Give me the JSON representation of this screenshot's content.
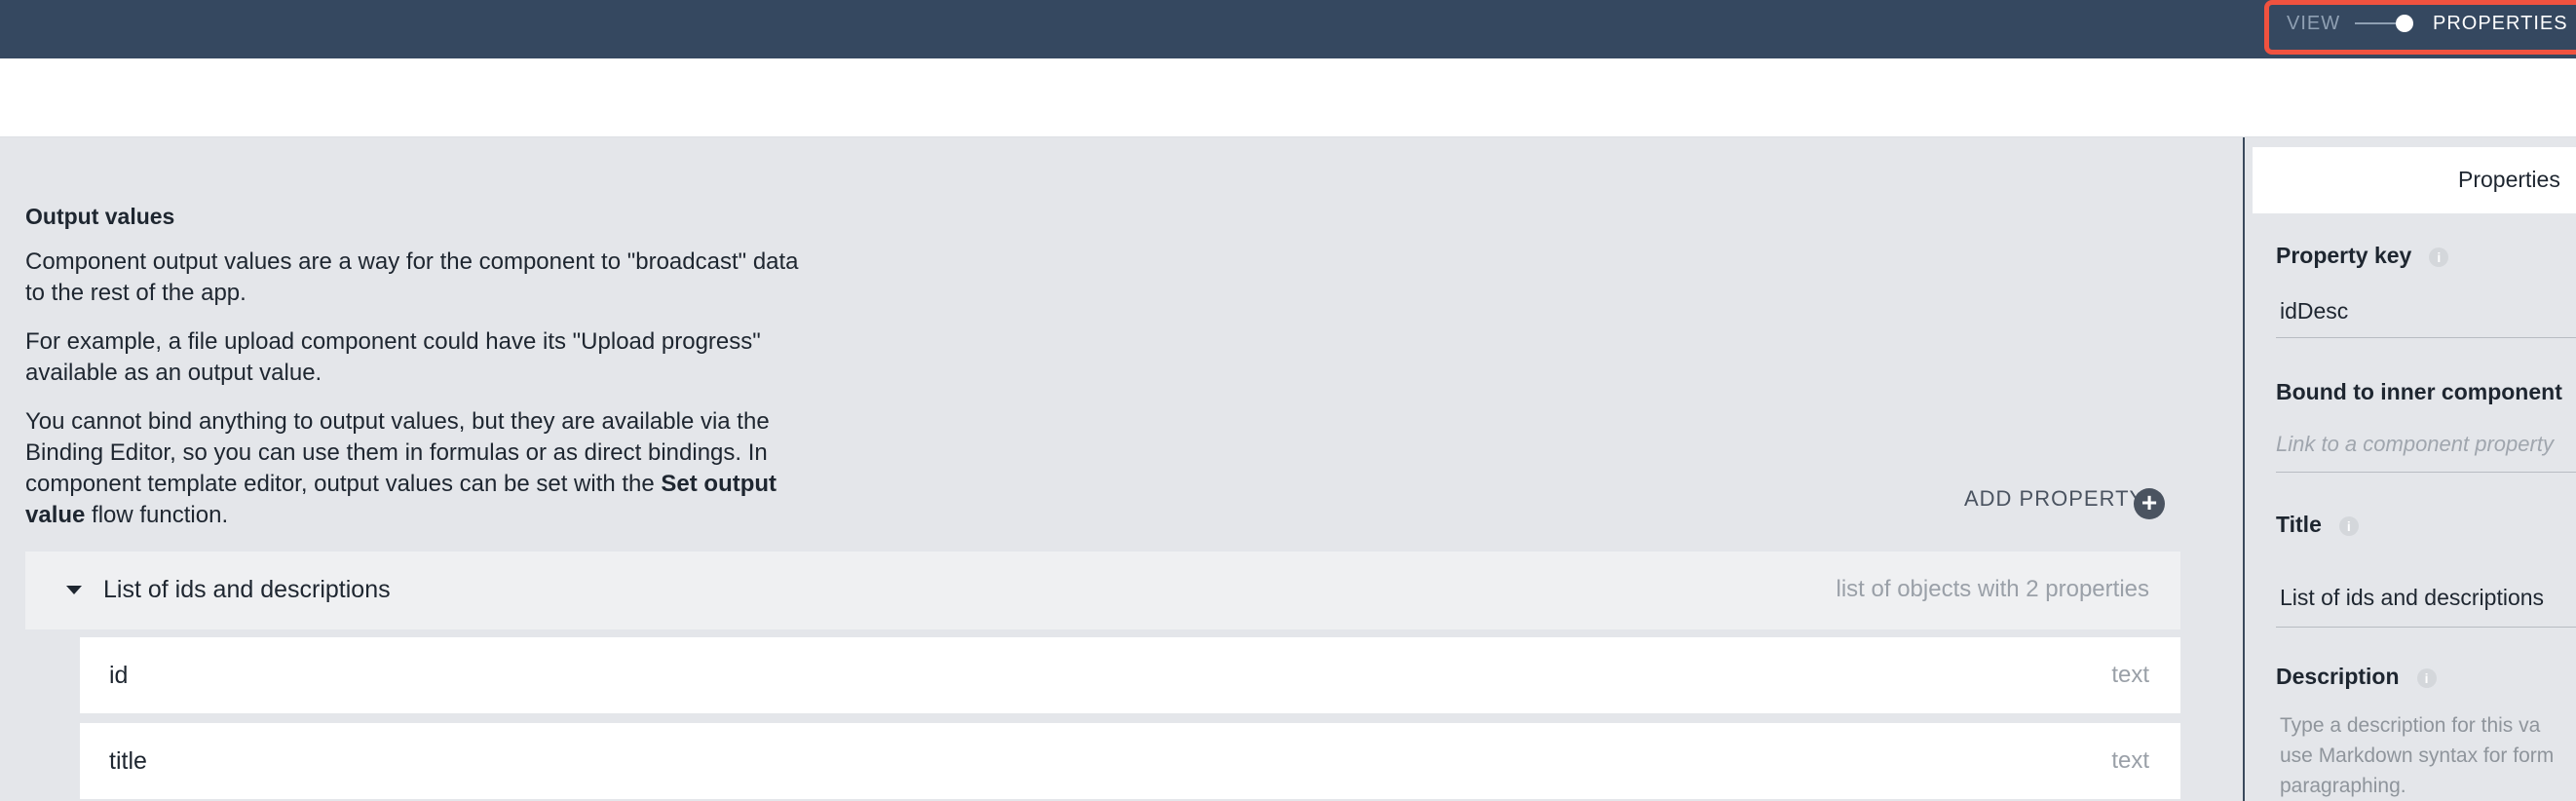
{
  "topbar": {
    "view_label": "VIEW",
    "properties_label": "PROPERTIES"
  },
  "main": {
    "heading": "Output values",
    "paragraph1": "Component output values are a way for the component to \"broadcast\" data to the rest of the app.",
    "paragraph2": "For example, a file upload component could have its \"Upload progress\" available as an output value.",
    "paragraph3_before": "You cannot bind anything to output values, but they are available via the Binding Editor, so you can use them in formulas or as direct bindings. In component template editor, output values can be set with the ",
    "paragraph3_bold": "Set output value",
    "paragraph3_after": " flow function.",
    "add_property": "ADD PROPERTY",
    "list": {
      "title": "List of ids and descriptions",
      "type": "list of objects with 2 properties",
      "rows": [
        {
          "label": "id",
          "type": "text"
        },
        {
          "label": "title",
          "type": "text"
        }
      ]
    }
  },
  "right_panel": {
    "header": "Properties",
    "property_key_label": "Property key",
    "property_key_value": "idDesc",
    "bound_label": "Bound to inner component",
    "bound_placeholder": "Link to a component property",
    "title_label": "Title",
    "title_value": "List of ids and descriptions",
    "description_label": "Description",
    "description_line1": "Type a description for this va",
    "description_line2": "use Markdown syntax for form",
    "description_line3": "paragraphing."
  }
}
